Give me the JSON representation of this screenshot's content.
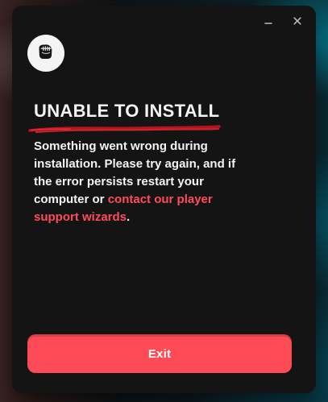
{
  "window": {
    "controls": {
      "minimize_icon": "minimize-icon",
      "close_icon": "close-icon"
    }
  },
  "branding": {
    "logo_icon": "riot-fist-icon"
  },
  "content": {
    "title": "UNABLE TO INSTALL",
    "message": {
      "line1": "Something went wrong during",
      "line2": "installation. Please try again, and if",
      "line3": "the error persists restart your",
      "line4_prefix": "computer or ",
      "link_text_1": "contact our player",
      "link_text_2": "support wizards",
      "line_suffix": "."
    }
  },
  "actions": {
    "exit_label": "Exit"
  },
  "colors": {
    "window_bg": "#141414",
    "accent": "#ff4b55",
    "link": "#ff4b5a",
    "text": "#f4f4f4"
  }
}
